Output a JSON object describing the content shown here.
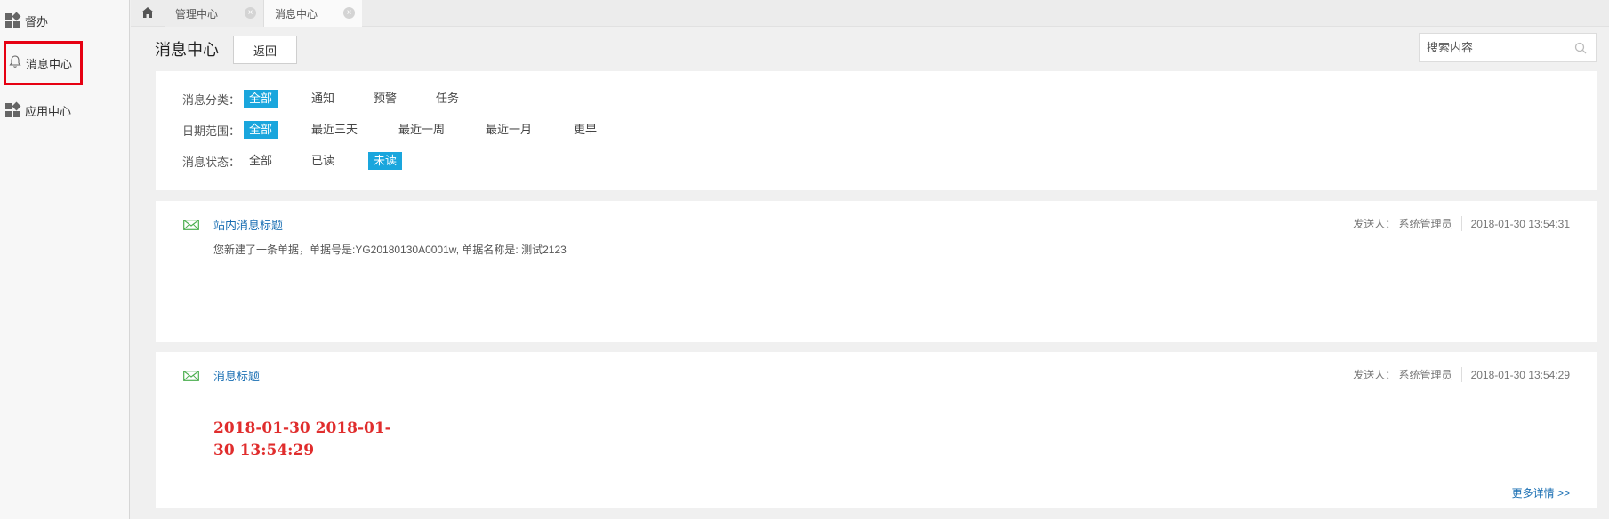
{
  "sidebar": {
    "items": [
      {
        "label": "督办",
        "icon": "grid-icon"
      },
      {
        "label": "消息中心",
        "icon": "bell-icon"
      },
      {
        "label": "应用中心",
        "icon": "grid-icon"
      }
    ]
  },
  "tabs": [
    {
      "label": "管理中心"
    },
    {
      "label": "消息中心"
    }
  ],
  "header": {
    "title": "消息中心",
    "back_label": "返回",
    "search_placeholder": "搜索内容"
  },
  "filters": {
    "category": {
      "label": "消息分类：",
      "options": [
        "全部",
        "通知",
        "预警",
        "任务"
      ],
      "selected": "全部"
    },
    "date": {
      "label": "日期范围：",
      "options": [
        "全部",
        "最近三天",
        "最近一周",
        "最近一月",
        "更早"
      ],
      "selected": "全部"
    },
    "status": {
      "label": "消息状态：",
      "options": [
        "全部",
        "已读",
        "未读"
      ],
      "selected": "未读"
    }
  },
  "messages": [
    {
      "title": "站内消息标题",
      "sender": "发送人： 系统管理员",
      "time": "2018-01-30 13:54:31",
      "body": "您新建了一条单据，单据号是:YG20180130A0001w, 单据名称是: 测试2123"
    },
    {
      "title": "消息标题",
      "sender": "发送人： 系统管理员",
      "time": "2018-01-30 13:54:29",
      "body_highlight": "2018-01-30 2018-01-30 13:54:29",
      "more_label": "更多详情 >>"
    }
  ],
  "colors": {
    "accent": "#1aa6dd",
    "link": "#1a6fb3",
    "highlight_red": "#e02d2d",
    "active_box": "#e60012",
    "mail_icon": "#4caf50"
  }
}
